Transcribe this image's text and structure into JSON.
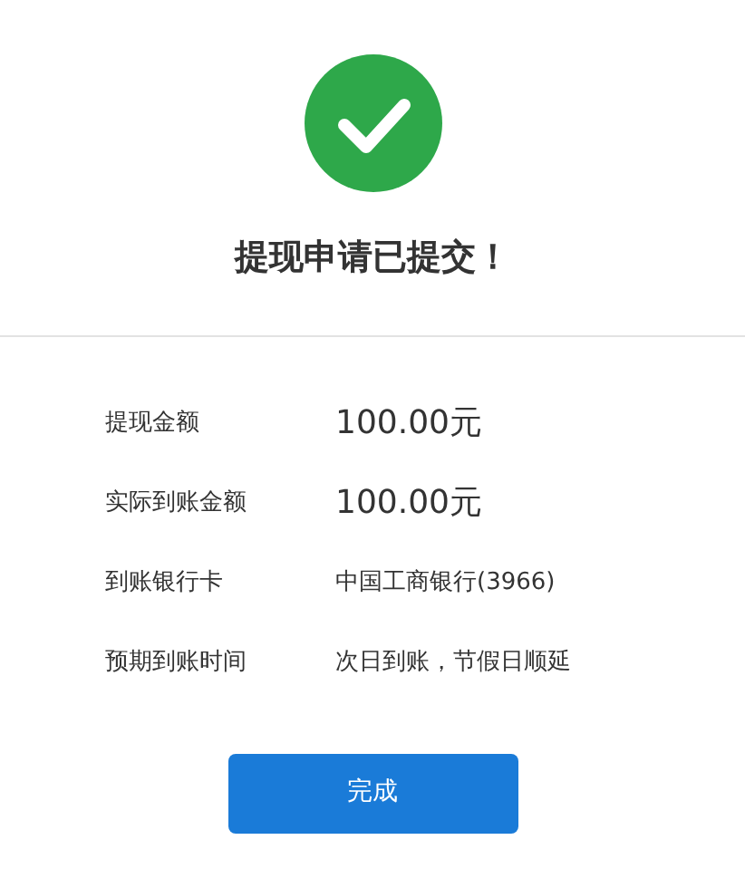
{
  "title": "提现申请已提交！",
  "details": [
    {
      "label": "提现金额",
      "value": "100.00元",
      "kind": "amount"
    },
    {
      "label": "实际到账金额",
      "value": "100.00元",
      "kind": "amount"
    },
    {
      "label": "到账银行卡",
      "value": "中国工商银行(3966)",
      "kind": "text"
    },
    {
      "label": "预期到账时间",
      "value": "次日到账，节假日顺延",
      "kind": "text"
    }
  ],
  "button": "完成"
}
